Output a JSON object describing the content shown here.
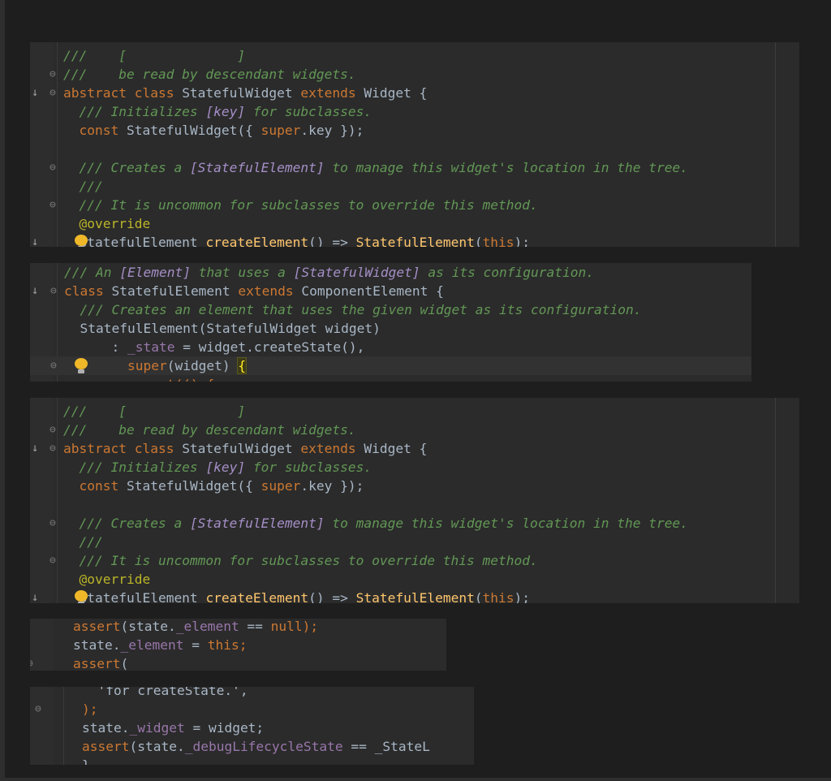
{
  "panels": [
    {
      "id": "snippet-1",
      "lines": [
        {
          "arrow": "",
          "fold": "",
          "tokens": [
            {
              "t": "///    [",
              "c": "c-doc"
            },
            {
              "t": "              ",
              "c": "c-doc"
            },
            {
              "t": "]  ",
              "c": "c-doc"
            }
          ]
        },
        {
          "arrow": "",
          "fold": "⊖",
          "tokens": [
            {
              "t": "///    be read by descendant widgets.",
              "c": "c-doc"
            }
          ]
        },
        {
          "arrow": "↓",
          "fold": "⊖",
          "tokens": [
            {
              "t": "abstract class ",
              "c": "c-kw"
            },
            {
              "t": "StatefulWidget ",
              "c": ""
            },
            {
              "t": "extends ",
              "c": "c-kw"
            },
            {
              "t": "Widget {",
              "c": ""
            }
          ]
        },
        {
          "arrow": "",
          "fold": "",
          "tokens": [
            {
              "t": "  /// Initializes ",
              "c": "c-doc"
            },
            {
              "t": "[key]",
              "c": "c-ref"
            },
            {
              "t": " for subclasses.",
              "c": "c-doc"
            }
          ]
        },
        {
          "arrow": "",
          "fold": "",
          "tokens": [
            {
              "t": "  ",
              "c": ""
            },
            {
              "t": "const ",
              "c": "c-kw"
            },
            {
              "t": "StatefulWidget({ ",
              "c": ""
            },
            {
              "t": "super",
              "c": "c-kw"
            },
            {
              "t": ".key });",
              "c": ""
            }
          ]
        },
        {
          "arrow": "",
          "fold": "",
          "tokens": []
        },
        {
          "arrow": "",
          "fold": "⊖",
          "tokens": [
            {
              "t": "  /// Creates a ",
              "c": "c-doc"
            },
            {
              "t": "[StatefulElement]",
              "c": "c-ref"
            },
            {
              "t": " to manage this widget's location in the tree.",
              "c": "c-doc"
            }
          ]
        },
        {
          "arrow": "",
          "fold": "",
          "tokens": [
            {
              "t": "  ///",
              "c": "c-doc"
            }
          ]
        },
        {
          "arrow": "",
          "fold": "⊖",
          "tokens": [
            {
              "t": "  /// It is uncommon for subclasses to override this method.",
              "c": "c-doc"
            }
          ]
        },
        {
          "arrow": "",
          "fold": "",
          "tokens": [
            {
              "t": "  @override",
              "c": "c-ann"
            }
          ]
        },
        {
          "arrow": "↓",
          "fold": "",
          "bulb": true,
          "tokens": [
            {
              "t": "  StatefulElement ",
              "c": ""
            },
            {
              "t": "createElement",
              "c": "c-fn"
            },
            {
              "t": "() => ",
              "c": ""
            },
            {
              "t": "StatefulElement",
              "c": "c-fn"
            },
            {
              "t": "(",
              "c": ""
            },
            {
              "t": "this",
              "c": "c-kw"
            },
            {
              "t": ");",
              "c": ""
            }
          ]
        }
      ]
    },
    {
      "id": "snippet-2",
      "lines": [
        {
          "arrow": "",
          "fold": "",
          "tokens": [
            {
              "t": "/// An ",
              "c": "c-doc"
            },
            {
              "t": "[Element]",
              "c": "c-ref"
            },
            {
              "t": " that uses a ",
              "c": "c-doc"
            },
            {
              "t": "[StatefulWidget]",
              "c": "c-ref"
            },
            {
              "t": " as its configuration.",
              "c": "c-doc"
            }
          ]
        },
        {
          "arrow": "↓",
          "fold": "⊖",
          "tokens": [
            {
              "t": "class ",
              "c": "c-kw"
            },
            {
              "t": "StatefulElement ",
              "c": ""
            },
            {
              "t": "extends ",
              "c": "c-kw"
            },
            {
              "t": "ComponentElement {",
              "c": ""
            }
          ]
        },
        {
          "arrow": "",
          "fold": "",
          "tokens": [
            {
              "t": "  /// Creates an element that uses the given widget as its configuration.",
              "c": "c-doc"
            }
          ]
        },
        {
          "arrow": "",
          "fold": "",
          "tokens": [
            {
              "t": "  StatefulElement(StatefulWidget widget)",
              "c": ""
            }
          ]
        },
        {
          "arrow": "",
          "fold": "",
          "tokens": [
            {
              "t": "      : ",
              "c": ""
            },
            {
              "t": "_state",
              "c": "c-fld"
            },
            {
              "t": " = widget.createState(),",
              "c": ""
            }
          ]
        },
        {
          "arrow": "",
          "fold": "⊖",
          "bulb": true,
          "current": true,
          "tokens": [
            {
              "t": "        ",
              "c": ""
            },
            {
              "t": "super",
              "c": "c-kw"
            },
            {
              "t": "(widget) ",
              "c": ""
            },
            {
              "t": "{",
              "c": "brace"
            }
          ]
        },
        {
          "arrow": "",
          "fold": "",
          "tokens": [
            {
              "t": "        assert(() {",
              "c": "c-kw"
            }
          ]
        }
      ]
    },
    {
      "id": "snippet-3",
      "lines": [
        {
          "arrow": "",
          "fold": "",
          "tokens": [
            {
              "t": "///    [",
              "c": "c-doc"
            },
            {
              "t": "              ",
              "c": "c-doc"
            },
            {
              "t": "]  ",
              "c": "c-doc"
            }
          ]
        },
        {
          "arrow": "",
          "fold": "⊖",
          "tokens": [
            {
              "t": "///    be read by descendant widgets.",
              "c": "c-doc"
            }
          ]
        },
        {
          "arrow": "↓",
          "fold": "⊖",
          "tokens": [
            {
              "t": "abstract class ",
              "c": "c-kw"
            },
            {
              "t": "StatefulWidget ",
              "c": ""
            },
            {
              "t": "extends ",
              "c": "c-kw"
            },
            {
              "t": "Widget {",
              "c": ""
            }
          ]
        },
        {
          "arrow": "",
          "fold": "",
          "tokens": [
            {
              "t": "  /// Initializes ",
              "c": "c-doc"
            },
            {
              "t": "[key]",
              "c": "c-ref"
            },
            {
              "t": " for subclasses.",
              "c": "c-doc"
            }
          ]
        },
        {
          "arrow": "",
          "fold": "",
          "tokens": [
            {
              "t": "  ",
              "c": ""
            },
            {
              "t": "const ",
              "c": "c-kw"
            },
            {
              "t": "StatefulWidget({ ",
              "c": ""
            },
            {
              "t": "super",
              "c": "c-kw"
            },
            {
              "t": ".key });",
              "c": ""
            }
          ]
        },
        {
          "arrow": "",
          "fold": "",
          "tokens": []
        },
        {
          "arrow": "",
          "fold": "⊖",
          "tokens": [
            {
              "t": "  /// Creates a ",
              "c": "c-doc"
            },
            {
              "t": "[StatefulElement]",
              "c": "c-ref"
            },
            {
              "t": " to manage this widget's location in the tree.",
              "c": "c-doc"
            }
          ]
        },
        {
          "arrow": "",
          "fold": "",
          "tokens": [
            {
              "t": "  ///",
              "c": "c-doc"
            }
          ]
        },
        {
          "arrow": "",
          "fold": "⊖",
          "tokens": [
            {
              "t": "  /// It is uncommon for subclasses to override this method.",
              "c": "c-doc"
            }
          ]
        },
        {
          "arrow": "",
          "fold": "",
          "tokens": [
            {
              "t": "  @override",
              "c": "c-ann"
            }
          ]
        },
        {
          "arrow": "↓",
          "fold": "",
          "bulb": true,
          "tokens": [
            {
              "t": "  StatefulElement ",
              "c": ""
            },
            {
              "t": "createElement",
              "c": "c-fn"
            },
            {
              "t": "() => ",
              "c": ""
            },
            {
              "t": "StatefulElement",
              "c": "c-fn"
            },
            {
              "t": "(",
              "c": ""
            },
            {
              "t": "this",
              "c": "c-kw"
            },
            {
              "t": ");",
              "c": ""
            }
          ]
        }
      ]
    },
    {
      "id": "snippet-4",
      "lines": [
        {
          "arrow": "",
          "fold": "",
          "tokens": [
            {
              "t": "assert",
              "c": "c-kw"
            },
            {
              "t": "(state.",
              "c": ""
            },
            {
              "t": "_element",
              "c": "c-fld"
            },
            {
              "t": " == ",
              "c": ""
            },
            {
              "t": "null",
              "c": "c-kw"
            },
            {
              "t": ");",
              "c": "c-kw"
            }
          ]
        },
        {
          "arrow": "",
          "fold": "",
          "tokens": [
            {
              "t": "state.",
              "c": ""
            },
            {
              "t": "_element",
              "c": "c-fld"
            },
            {
              "t": " = ",
              "c": ""
            },
            {
              "t": "this",
              "c": "c-kw"
            },
            {
              "t": ";",
              "c": "c-kw"
            }
          ]
        },
        {
          "arrow": "",
          "fold": "⊖",
          "tokens": [
            {
              "t": "assert",
              "c": "c-kw"
            },
            {
              "t": "(",
              "c": ""
            }
          ]
        }
      ]
    },
    {
      "id": "snippet-5",
      "lines": [
        {
          "arrow": "",
          "fold": "",
          "tokens": [
            {
              "t": "  'for createState.',",
              "c": ""
            }
          ]
        },
        {
          "arrow": "",
          "fold": "⊖",
          "tokens": [
            {
              "t": ");",
              "c": "c-kw"
            }
          ]
        },
        {
          "arrow": "",
          "fold": "",
          "tokens": [
            {
              "t": "state.",
              "c": ""
            },
            {
              "t": "_widget",
              "c": "c-fld"
            },
            {
              "t": " = widget;",
              "c": ""
            }
          ]
        },
        {
          "arrow": "",
          "fold": "",
          "tokens": [
            {
              "t": "assert",
              "c": "c-kw"
            },
            {
              "t": "(state.",
              "c": ""
            },
            {
              "t": "_debugLifecycleState",
              "c": "c-fld"
            },
            {
              "t": " == _StateL",
              "c": ""
            }
          ]
        },
        {
          "arrow": "",
          "fold": "",
          "tokens": [
            {
              "t": "}",
              "c": ""
            }
          ]
        }
      ]
    }
  ]
}
